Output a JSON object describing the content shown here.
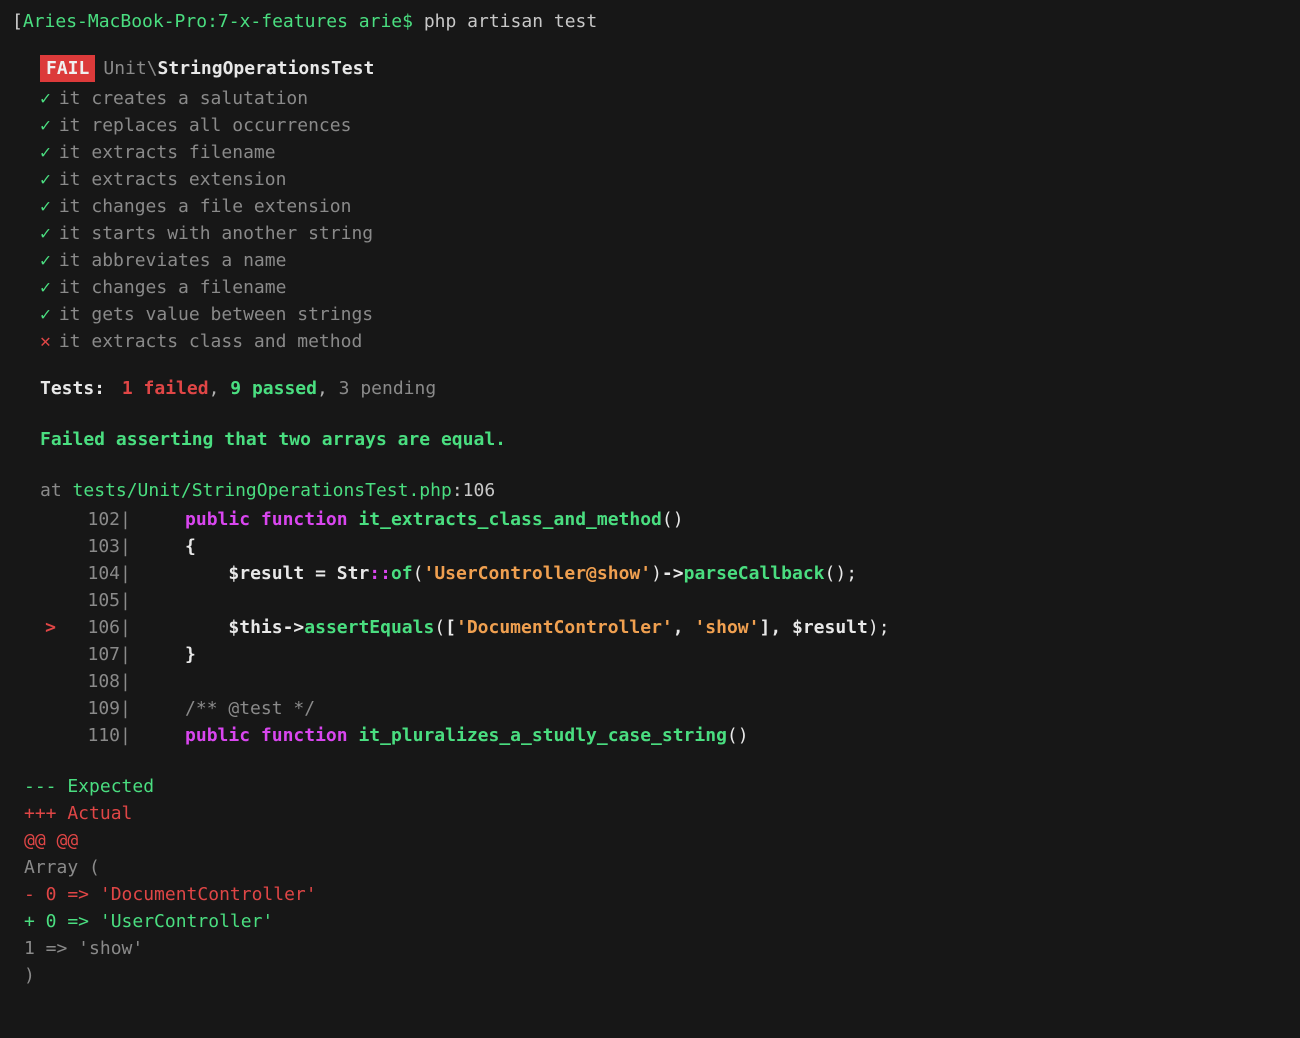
{
  "prompt": {
    "bracket": "[",
    "host": "Aries-MacBook-Pro:7-x-features arie$",
    "command": "php artisan test"
  },
  "header": {
    "badge": "FAIL",
    "namespace": "Unit\\",
    "classname": "StringOperationsTest"
  },
  "tests": [
    {
      "icon": "✓",
      "status": "pass",
      "name": "it creates a salutation"
    },
    {
      "icon": "✓",
      "status": "pass",
      "name": "it replaces all occurrences"
    },
    {
      "icon": "✓",
      "status": "pass",
      "name": "it extracts filename"
    },
    {
      "icon": "✓",
      "status": "pass",
      "name": "it extracts extension"
    },
    {
      "icon": "✓",
      "status": "pass",
      "name": "it changes a file extension"
    },
    {
      "icon": "✓",
      "status": "pass",
      "name": "it starts with another string"
    },
    {
      "icon": "✓",
      "status": "pass",
      "name": "it abbreviates a name"
    },
    {
      "icon": "✓",
      "status": "pass",
      "name": "it changes a filename"
    },
    {
      "icon": "✓",
      "status": "pass",
      "name": "it gets value between strings"
    },
    {
      "icon": "✕",
      "status": "fail",
      "name": "it extracts class and method"
    }
  ],
  "summary": {
    "label": "Tests:",
    "failed": "1 failed",
    "passed": "9 passed",
    "pending": "3 pending"
  },
  "error": "Failed asserting that two arrays are equal.",
  "location": {
    "at": "at ",
    "path": "tests/Unit/StringOperationsTest.php",
    "line": ":106"
  },
  "code": {
    "l102": {
      "num": "102",
      "kw1": "public",
      "kw2": "function",
      "fn": "it_extracts_class_and_method"
    },
    "l103": {
      "num": "103",
      "brace": "{"
    },
    "l104": {
      "num": "104",
      "var": "$result",
      "eq": " = ",
      "cls": "Str",
      "scope": "::",
      "m1": "of",
      "str": "'UserController@show'",
      "arrow": "->",
      "m2": "parseCallback",
      "semi": ";"
    },
    "l105": {
      "num": "105"
    },
    "l106": {
      "num": "106",
      "marker": ">",
      "var": "$this",
      "arrow": "->",
      "m1": "assertEquals",
      "str1": "'DocumentController'",
      "comma": ", ",
      "str2": "'show'",
      "var2": "$result",
      "semi": ";"
    },
    "l107": {
      "num": "107",
      "brace": "}"
    },
    "l108": {
      "num": "108"
    },
    "l109": {
      "num": "109",
      "comment": "/** @test */"
    },
    "l110": {
      "num": "110",
      "kw1": "public",
      "kw2": "function",
      "fn": "it_pluralizes_a_studly_case_string"
    }
  },
  "diff": {
    "expected": "--- Expected",
    "actual": "+++ Actual",
    "hunk": "@@ @@",
    "array_open": " Array (",
    "minus": "-    0 => 'DocumentController'",
    "plus": "+    0 => 'UserController'",
    "common": "     1 => 'show'",
    "array_close": " )"
  }
}
